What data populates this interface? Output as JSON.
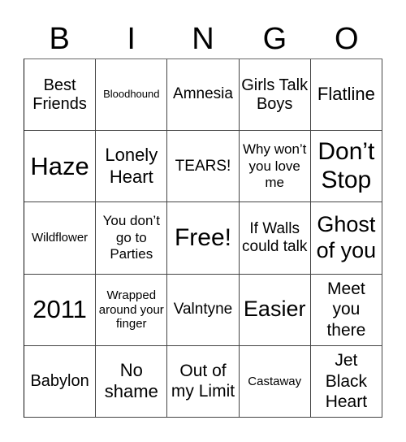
{
  "header": [
    "B",
    "I",
    "N",
    "G",
    "O"
  ],
  "cells": [
    [
      "Best Friends",
      "Bloodhound",
      "Amnesia",
      "Girls Talk Boys",
      "Flatline"
    ],
    [
      "Haze",
      "Lonely Heart",
      "TEARS!",
      "Why won’t you love me",
      "Don’t Stop"
    ],
    [
      "Wildflower",
      "You don’t go to Parties",
      "Free!",
      "If Walls could talk",
      "Ghost of you"
    ],
    [
      "2011",
      "Wrapped around your finger",
      "Valntyne",
      "Easier",
      "Meet you there"
    ],
    [
      "Babylon",
      "No shame",
      "Out of my Limit",
      "Castaway",
      "Jet Black Heart"
    ]
  ],
  "free_space": {
    "row": 2,
    "col": 2,
    "label": "Free!"
  }
}
